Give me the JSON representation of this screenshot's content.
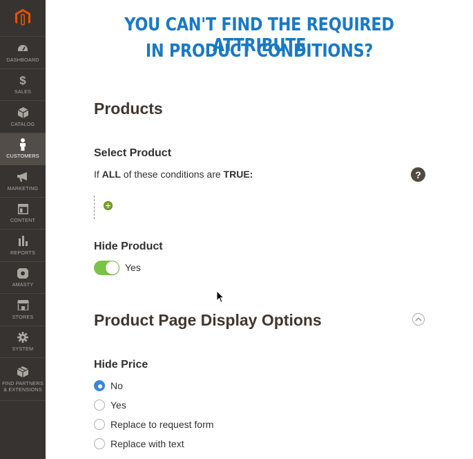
{
  "sidebar": {
    "logo": "magento-logo",
    "items": [
      {
        "label": "DASHBOARD",
        "icon": "dashboard-icon"
      },
      {
        "label": "SALES",
        "icon": "dollar-icon"
      },
      {
        "label": "CATALOG",
        "icon": "cube-icon"
      },
      {
        "label": "CUSTOMERS",
        "icon": "person-icon",
        "active": true
      },
      {
        "label": "MARKETING",
        "icon": "megaphone-icon"
      },
      {
        "label": "CONTENT",
        "icon": "layout-icon"
      },
      {
        "label": "REPORTS",
        "icon": "bar-chart-icon"
      },
      {
        "label": "AMASTY",
        "icon": "amasty-icon"
      },
      {
        "label": "STORES",
        "icon": "storefront-icon"
      },
      {
        "label": "SYSTEM",
        "icon": "gear-icon"
      },
      {
        "label": "FIND PARTNERS & EXTENSIONS",
        "icon": "box-icon"
      }
    ]
  },
  "banner": {
    "line1": "YOU CAN'T FIND THE REQUIRED ATTRIBUTE",
    "line2": "IN PRODUCT CONDITIONS?"
  },
  "products_section": {
    "title": "Products",
    "select_product_label": "Select Product",
    "conditions": {
      "prefix": "If",
      "aggregator": "ALL",
      "middle": "of these conditions are",
      "value": "TRUE",
      "suffix": ":"
    },
    "help_symbol": "?",
    "hide_product_label": "Hide Product",
    "hide_product_toggle": {
      "on": true,
      "label": "Yes"
    }
  },
  "display_section": {
    "title": "Product Page Display Options",
    "hide_price_label": "Hide Price",
    "hide_price_options": [
      "No",
      "Yes",
      "Replace to request form",
      "Replace with text"
    ],
    "hide_price_selected": "No"
  },
  "colors": {
    "sidebar_bg": "#373330",
    "sidebar_active": "#524d49",
    "banner_blue": "#1979c3",
    "toggle_green": "#79c347",
    "radio_blue": "#3b86d6",
    "magento_orange": "#eb5202"
  }
}
